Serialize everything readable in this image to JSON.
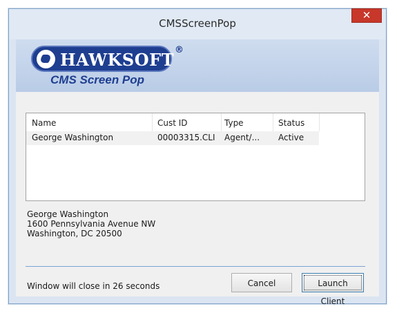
{
  "window": {
    "title": "CMSScreenPop",
    "close_label": "✕"
  },
  "banner": {
    "logo_text": "HAWKSOFT",
    "registered_mark": "®",
    "subtitle": "CMS Screen Pop"
  },
  "list": {
    "columns": [
      "Name",
      "Cust ID",
      "Type",
      "Status"
    ],
    "rows": [
      {
        "name": "George Washington",
        "cust_id": "00003315.CLI",
        "type": "Agent/...",
        "status": "Active"
      }
    ]
  },
  "address": {
    "line1": "George Washington",
    "line2": "1600 Pennsylvania Avenue NW",
    "line3": "Washington, DC 20500"
  },
  "footer": {
    "countdown": "Window will close in 26 seconds",
    "cancel_label": "Cancel",
    "launch_label": "Launch Client"
  },
  "colors": {
    "brand_blue": "#1e3e90",
    "close_red": "#c7372a",
    "divider_blue": "#7aa3d4"
  }
}
